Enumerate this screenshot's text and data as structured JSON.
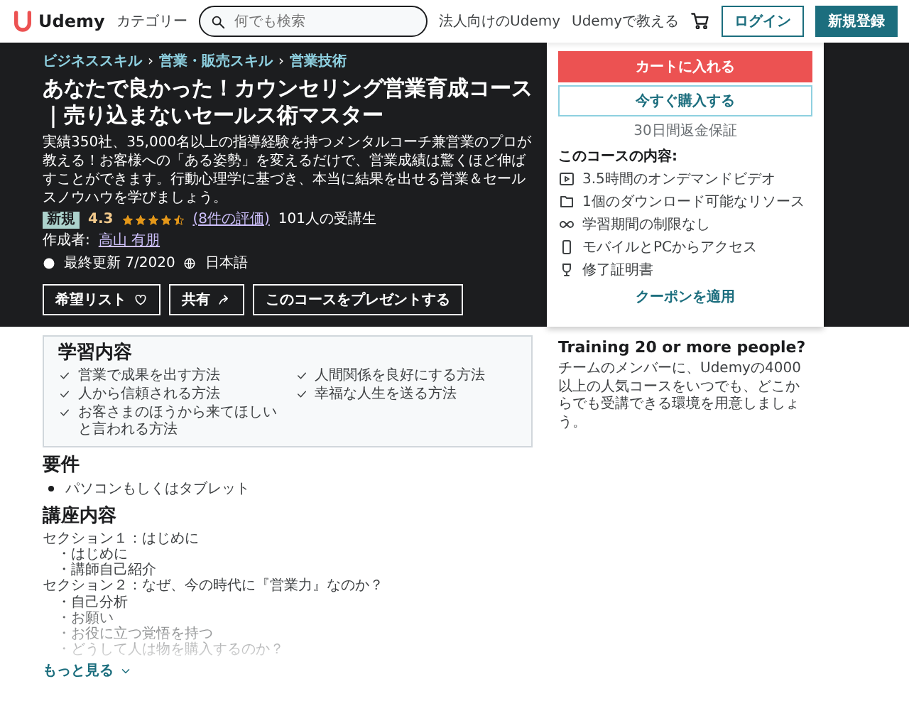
{
  "header": {
    "logo": "Udemy",
    "categories": "カテゴリー",
    "search": {
      "placeholder": "何でも検索"
    },
    "links": [
      "法人向けのUdemy",
      "Udemyで教える"
    ],
    "login": "ログイン",
    "signup": "新規登録"
  },
  "hero": {
    "breadcrumbs": [
      "ビジネススキル",
      "営業・販売スキル",
      "営業技術"
    ],
    "separator": "›",
    "title": "あなたで良かった！カウンセリング営業育成コース｜売り込まないセールス術マスター",
    "description": "実績350社、35,000名以上の指導経験を持つメンタルコーチ兼営業のプロが教える！お客様への「ある姿勢」を変えるだけで、営業成績は驚くほど伸ばすことができます。行動心理学に基づき、本当に結果を出せる営業＆セールスノウハウを学びましょう。",
    "badge": "新規",
    "rating": "4.3",
    "stars": 4.5,
    "rating_count": "(8件の評価)",
    "students": "101人の受講生",
    "author_label": "作成者:",
    "author": "高山 有朋",
    "updated": "最終更新 7/2020",
    "language": "日本語",
    "buttons": [
      "希望リスト",
      "共有",
      "このコースをプレゼントする"
    ]
  },
  "purchase": {
    "add_to_cart": "カートに入れる",
    "buy_now": "今すぐ購入する",
    "guarantee": "30日間返金保証",
    "includes_title": "このコースの内容:",
    "includes": [
      {
        "kind": "video",
        "text": "3.5時間のオンデマンドビデオ"
      },
      {
        "kind": "file",
        "text": "1個のダウンロード可能なリソース"
      },
      {
        "kind": "infinity",
        "text": "学習期間の制限なし"
      },
      {
        "kind": "mobile",
        "text": "モバイルとPCからアクセス"
      },
      {
        "kind": "certificate",
        "text": "修了証明書"
      }
    ],
    "coupon": "クーポンを適用"
  },
  "training": {
    "title": "Training 20 or more people?",
    "text": "チームのメンバーに、Udemyの4000以上の人気コースをいつでも、どこからでも受講できる環境を用意しましょう。"
  },
  "learn": {
    "title": "学習内容",
    "items": [
      "営業で成果を出す方法",
      "人間関係を良好にする方法",
      "人から信頼される方法",
      "幸福な人生を送る方法",
      "お客さまのほうから来てほしいと言われる方法"
    ]
  },
  "requirements": {
    "title": "要件",
    "items": [
      "パソコンもしくはタブレット"
    ]
  },
  "curriculum": {
    "title": "講座内容",
    "lines": [
      {
        "kind": "section",
        "text": "セクション１：はじめに"
      },
      {
        "kind": "lecture",
        "text": "・はじめに"
      },
      {
        "kind": "lecture",
        "text": "・講師自己紹介"
      },
      {
        "kind": "section",
        "text": "セクション２：なぜ、今の時代に『営業力』なのか？"
      },
      {
        "kind": "lecture",
        "text": "・自己分析"
      },
      {
        "kind": "lecture",
        "text": "・お願い"
      },
      {
        "kind": "lecture",
        "text": "・お役に立つ覚悟を持つ"
      },
      {
        "kind": "lecture",
        "text": "・どうして人は物を購入するのか？"
      }
    ],
    "more": "もっと見る"
  }
}
